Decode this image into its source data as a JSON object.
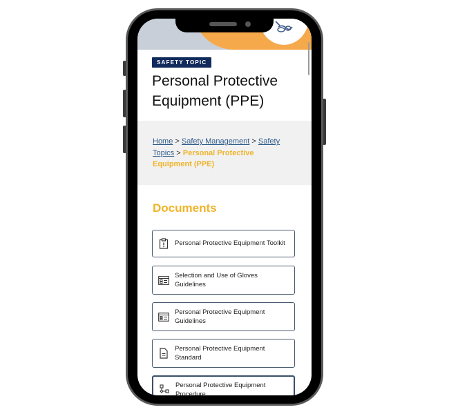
{
  "page": {
    "badge": "SAFETY TOPIC",
    "title": "Personal Protective Equipment (PPE)",
    "breadcrumb": {
      "items": [
        {
          "label": "Home"
        },
        {
          "label": "Safety Management"
        },
        {
          "label": "Safety Topics"
        }
      ],
      "separator": ">",
      "current": "Personal Protective Equipment (PPE)"
    },
    "documents_heading": "Documents",
    "documents": [
      {
        "label": "Personal Protective Equipment Toolkit",
        "icon": "clipboard-alert-icon"
      },
      {
        "label": "Selection and Use of Gloves Guidelines",
        "icon": "list-card-icon"
      },
      {
        "label": "Personal Protective Equipment Guidelines",
        "icon": "list-card-icon"
      },
      {
        "label": "Personal Protective Equipment Standard",
        "icon": "document-icon"
      },
      {
        "label": "Personal Protective Equipment Procedure",
        "icon": "flowchart-icon"
      }
    ]
  },
  "colors": {
    "accent": "#f0b429",
    "badge_bg": "#112a5c",
    "link": "#2f5c8a",
    "hero_orange": "#f6a94a",
    "hero_gray": "#c8cfd8"
  }
}
